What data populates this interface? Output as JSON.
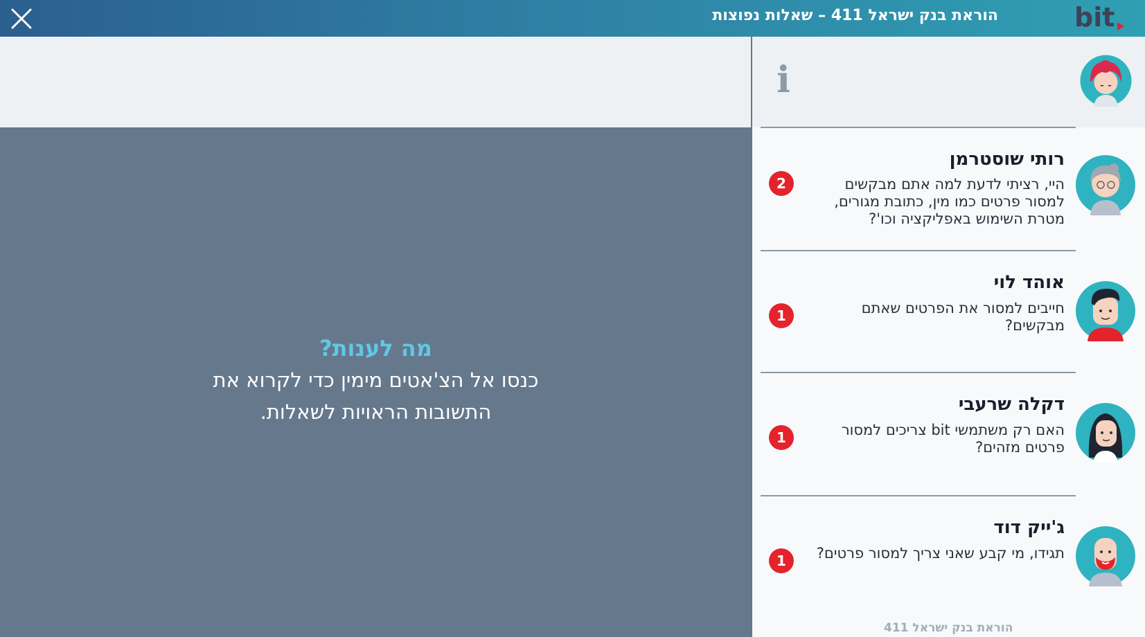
{
  "header": {
    "title": "הוראת בנק ישראל 411 – שאלות נפוצות",
    "logo_text": "bit",
    "close_icon": "close-icon"
  },
  "main": {
    "prompt_title": "מה לענות?",
    "prompt_text": "כנסו אל הצ'אטים מימין כדי לקרוא את התשובות הראויות לשאלות."
  },
  "sidebar": {
    "info_icon": "info-icon",
    "chats": [
      {
        "name": "רותי שוסטרמן",
        "message": "היי, רציתי לדעת למה אתם מבקשים למסור פרטים כמו מין, כתובת מגורים, מטרת השימוש באפליקציה וכו'?",
        "badge": "2"
      },
      {
        "name": "אוהד לוי",
        "message": "חייבים למסור את הפרטים שאתם מבקשים?",
        "badge": "1"
      },
      {
        "name": "דקלה שרעבי",
        "message": "האם רק משתמשי bit צריכים למסור פרטים מזהים?",
        "badge": "1"
      },
      {
        "name": "ג'ייק דוד",
        "message": "תגידו, מי קבע שאני צריך למסור פרטים?",
        "badge": "1"
      }
    ],
    "footer_link": "הוראת בנק ישראל 411"
  },
  "colors": {
    "accent": "#5fc8e6",
    "badge": "#e4232d",
    "panel": "#65788c",
    "avatar_bg": "#2fb3c0"
  }
}
